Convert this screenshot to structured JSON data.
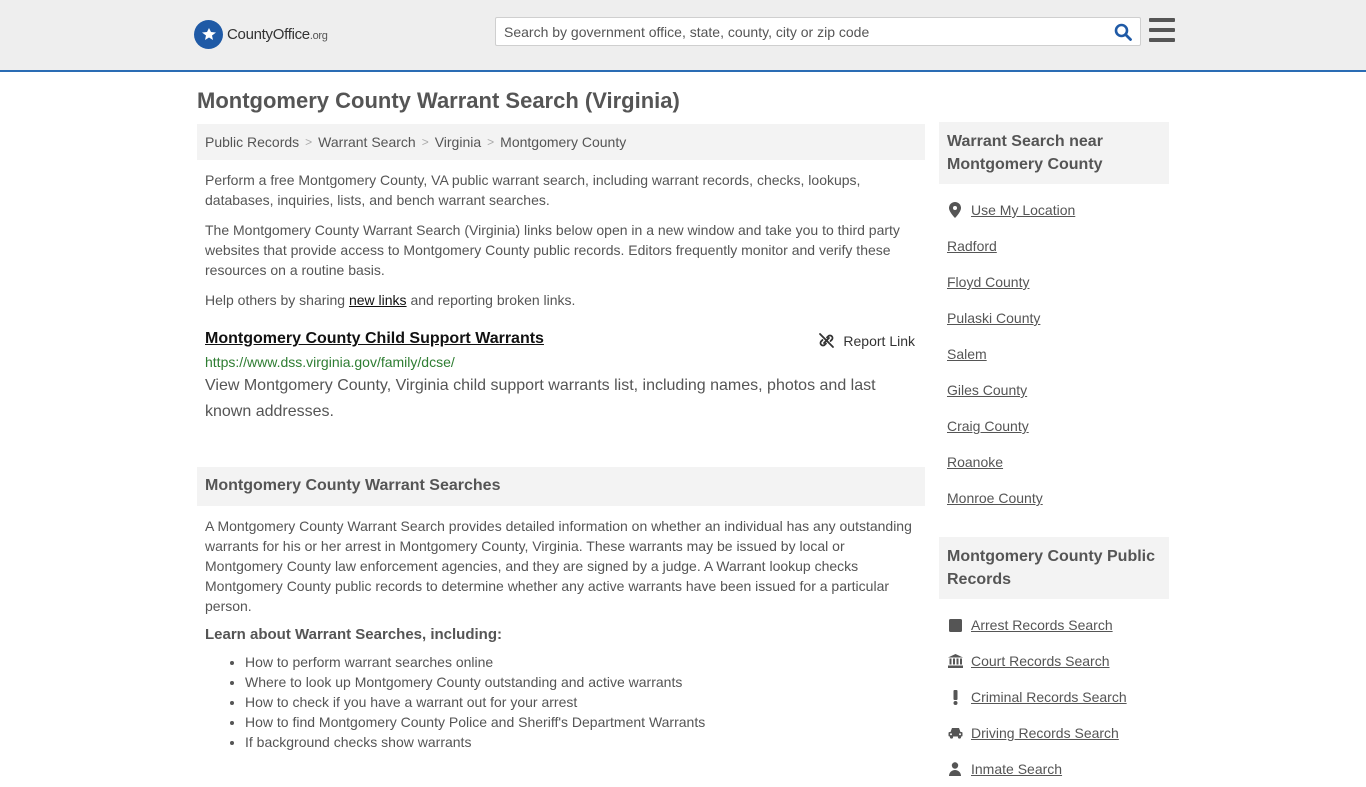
{
  "header": {
    "logo_brand": "County",
    "logo_brand2": "Office",
    "logo_tld": ".org",
    "search_placeholder": "Search by government office, state, county, city or zip code"
  },
  "page_title": "Montgomery County Warrant Search (Virginia)",
  "breadcrumb": [
    "Public Records",
    "Warrant Search",
    "Virginia",
    "Montgomery County"
  ],
  "intro": {
    "p1": "Perform a free Montgomery County, VA public warrant search, including warrant records, checks, lookups, databases, inquiries, lists, and bench warrant searches.",
    "p2": "The Montgomery County Warrant Search (Virginia) links below open in a new window and take you to third party websites that provide access to Montgomery County public records. Editors frequently monitor and verify these resources on a routine basis.",
    "p3_before": "Help others by sharing ",
    "p3_link": "new links",
    "p3_after": " and reporting broken links."
  },
  "result": {
    "title": "Montgomery County Child Support Warrants",
    "report_label": "Report Link",
    "url": "https://www.dss.virginia.gov/family/dcse/",
    "description": "View Montgomery County, Virginia child support warrants list, including names, photos and last known addresses."
  },
  "section": {
    "title": "Montgomery County Warrant Searches",
    "body": "A Montgomery County Warrant Search provides detailed information on whether an individual has any outstanding warrants for his or her arrest in Montgomery County, Virginia. These warrants may be issued by local or Montgomery County law enforcement agencies, and they are signed by a judge. A Warrant lookup checks Montgomery County public records to determine whether any active warrants have been issued for a particular person.",
    "sub_title": "Learn about Warrant Searches, including:",
    "items": [
      "How to perform warrant searches online",
      "Where to look up Montgomery County outstanding and active warrants",
      "How to check if you have a warrant out for your arrest",
      "How to find Montgomery County Police and Sheriff's Department Warrants",
      "If background checks show warrants"
    ]
  },
  "sidebar": {
    "near_title": "Warrant Search near Montgomery County",
    "use_location": "Use My Location",
    "near_links": [
      "Radford",
      "Floyd County",
      "Pulaski County",
      "Salem",
      "Giles County",
      "Craig County",
      "Roanoke",
      "Monroe County"
    ],
    "records_title": "Montgomery County Public Records",
    "records_links": [
      "Arrest Records Search",
      "Court Records Search",
      "Criminal Records Search",
      "Driving Records Search",
      "Inmate Search"
    ]
  },
  "colors": {
    "accent": "#2a6cb4",
    "url_green": "#2e7d32",
    "logo_blue": "#1f5aa6"
  }
}
